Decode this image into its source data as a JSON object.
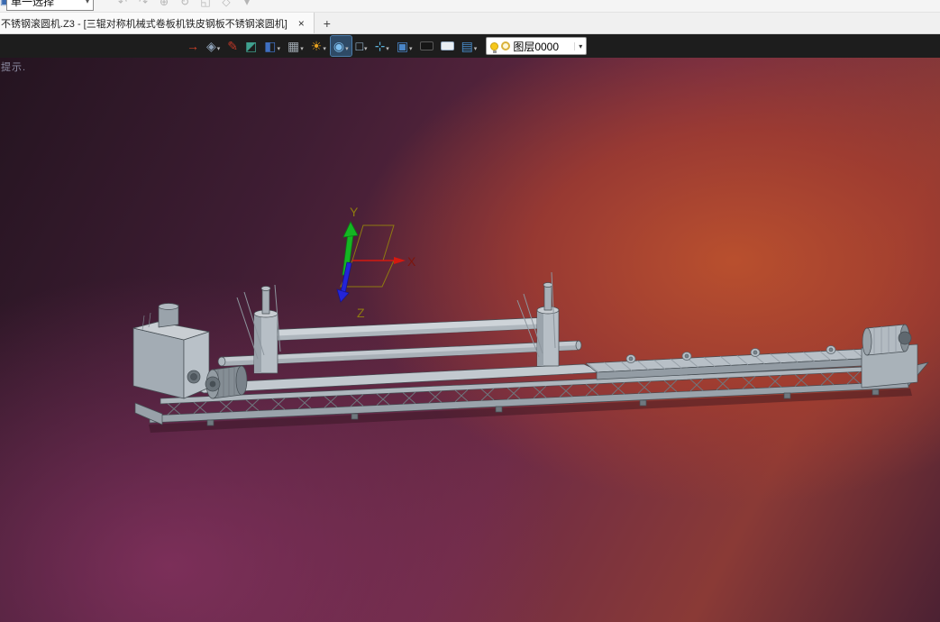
{
  "ui": {
    "caret_down": "▾"
  },
  "colors": {
    "ribbon_bg": "#1d1d1d",
    "tabbar_bg": "#f0f0f0",
    "viewport_bright": "#b4502d",
    "viewport_purple": "#8c3464",
    "viewport_dark": "#241420",
    "model_gray": "#b3bbc2",
    "axis_x": "#d41910",
    "axis_green": "#14b622",
    "axis_blue": "#2424d8",
    "axis_label_olive": "#8f7a10",
    "axis_label_x": "#7c150d"
  },
  "top_bar": {
    "selection_combo": {
      "value": "单一选择"
    },
    "icons": [
      {
        "name": "undo",
        "glyph": "↶",
        "color": "#b5b5b5"
      },
      {
        "name": "redo",
        "glyph": "↷",
        "color": "#b5b5b5"
      },
      {
        "name": "pan-view",
        "glyph": "⊕",
        "color": "#b5b5b5"
      },
      {
        "name": "rotate-view",
        "glyph": "↻",
        "color": "#b5b5b5"
      },
      {
        "name": "zoom-window",
        "glyph": "◱",
        "color": "#b5b5b5"
      },
      {
        "name": "fit-view",
        "glyph": "◇",
        "color": "#b5b5b5"
      },
      {
        "name": "view-settings",
        "glyph": "▾",
        "color": "#b5b5b5"
      }
    ]
  },
  "tab_bar": {
    "active_tab": {
      "title": "不锈钢滚圆机.Z3 - [三辊对称机械式卷板机铁皮钢板不锈钢滚圆机]",
      "close": "×"
    },
    "new_tab": "+"
  },
  "toolbar": {
    "icons": [
      {
        "name": "exit-environment",
        "glyph": "→",
        "color": "#d04028",
        "caret": false
      },
      {
        "name": "view-orientation",
        "glyph": "◈",
        "color": "#8fa2b8",
        "caret": true
      },
      {
        "name": "sketch-pen",
        "glyph": "✎",
        "color": "#c03828",
        "caret": false
      },
      {
        "name": "solid-shell",
        "glyph": "◩",
        "color": "#3fa08e",
        "caret": false
      },
      {
        "name": "shaded-display",
        "glyph": "◧",
        "color": "#3f6fc0",
        "caret": true
      },
      {
        "name": "wireframe-display",
        "glyph": "▦",
        "color": "#9fa8b0",
        "caret": true
      },
      {
        "name": "render-effects",
        "glyph": "☀",
        "color": "#e8a21e",
        "caret": true
      },
      {
        "name": "zoom-tools",
        "glyph": "◉",
        "color": "#7ec0f0",
        "caret": true,
        "active": true
      },
      {
        "name": "selection-box",
        "glyph": "□",
        "color": "#a8cce8",
        "caret": true
      },
      {
        "name": "datum-display",
        "glyph": "⊹",
        "color": "#5ab0d8",
        "caret": true
      },
      {
        "name": "display-settings",
        "glyph": "▣",
        "color": "#4a86c8",
        "caret": true
      },
      {
        "name": "line-color",
        "swatch": "#161616",
        "border": "#5a5a5a",
        "caret": false
      },
      {
        "name": "background-color",
        "swatch": "#e9eef3",
        "border": "#9ab0c8",
        "caret": false
      },
      {
        "name": "layer-manager",
        "glyph": "▤",
        "color": "#4a90d0",
        "caret": true
      }
    ],
    "layer_combo": {
      "label": "图层0000"
    }
  },
  "viewport": {
    "hint": "提示.",
    "axis": {
      "x": "X",
      "y": "Y",
      "z": "Z"
    }
  }
}
